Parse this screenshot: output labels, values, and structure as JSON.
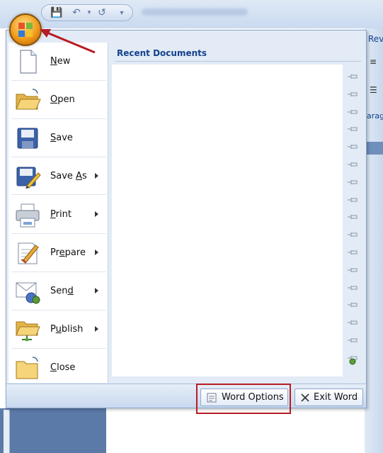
{
  "ribbon": {
    "tab_partial": "Rev",
    "group_partial": "arag"
  },
  "menu": {
    "items": [
      {
        "label": "New",
        "access_key": "N",
        "icon": "new-document-icon",
        "has_submenu": false
      },
      {
        "label": "Open",
        "access_key": "O",
        "icon": "open-folder-icon",
        "has_submenu": false
      },
      {
        "label": "Save",
        "access_key": "S",
        "icon": "save-disk-icon",
        "has_submenu": false
      },
      {
        "label": "Save As",
        "access_key": "A",
        "icon": "save-as-icon",
        "has_submenu": true
      },
      {
        "label": "Print",
        "access_key": "P",
        "icon": "printer-icon",
        "has_submenu": true
      },
      {
        "label": "Prepare",
        "access_key": "e",
        "icon": "prepare-pen-icon",
        "has_submenu": true
      },
      {
        "label": "Send",
        "access_key": "d",
        "icon": "send-icon",
        "has_submenu": true
      },
      {
        "label": "Publish",
        "access_key": "u",
        "icon": "publish-icon",
        "has_submenu": true
      },
      {
        "label": "Close",
        "access_key": "C",
        "icon": "close-folder-icon",
        "has_submenu": false
      }
    ]
  },
  "recent": {
    "title": "Recent Documents"
  },
  "buttons": {
    "word_options": "Word Options",
    "exit_word": "Exit Word"
  },
  "colors": {
    "menu_bg": "#e2ebf6",
    "title_text": "#15428b",
    "highlight": "#b81c25",
    "arrow": "#b81c25"
  }
}
